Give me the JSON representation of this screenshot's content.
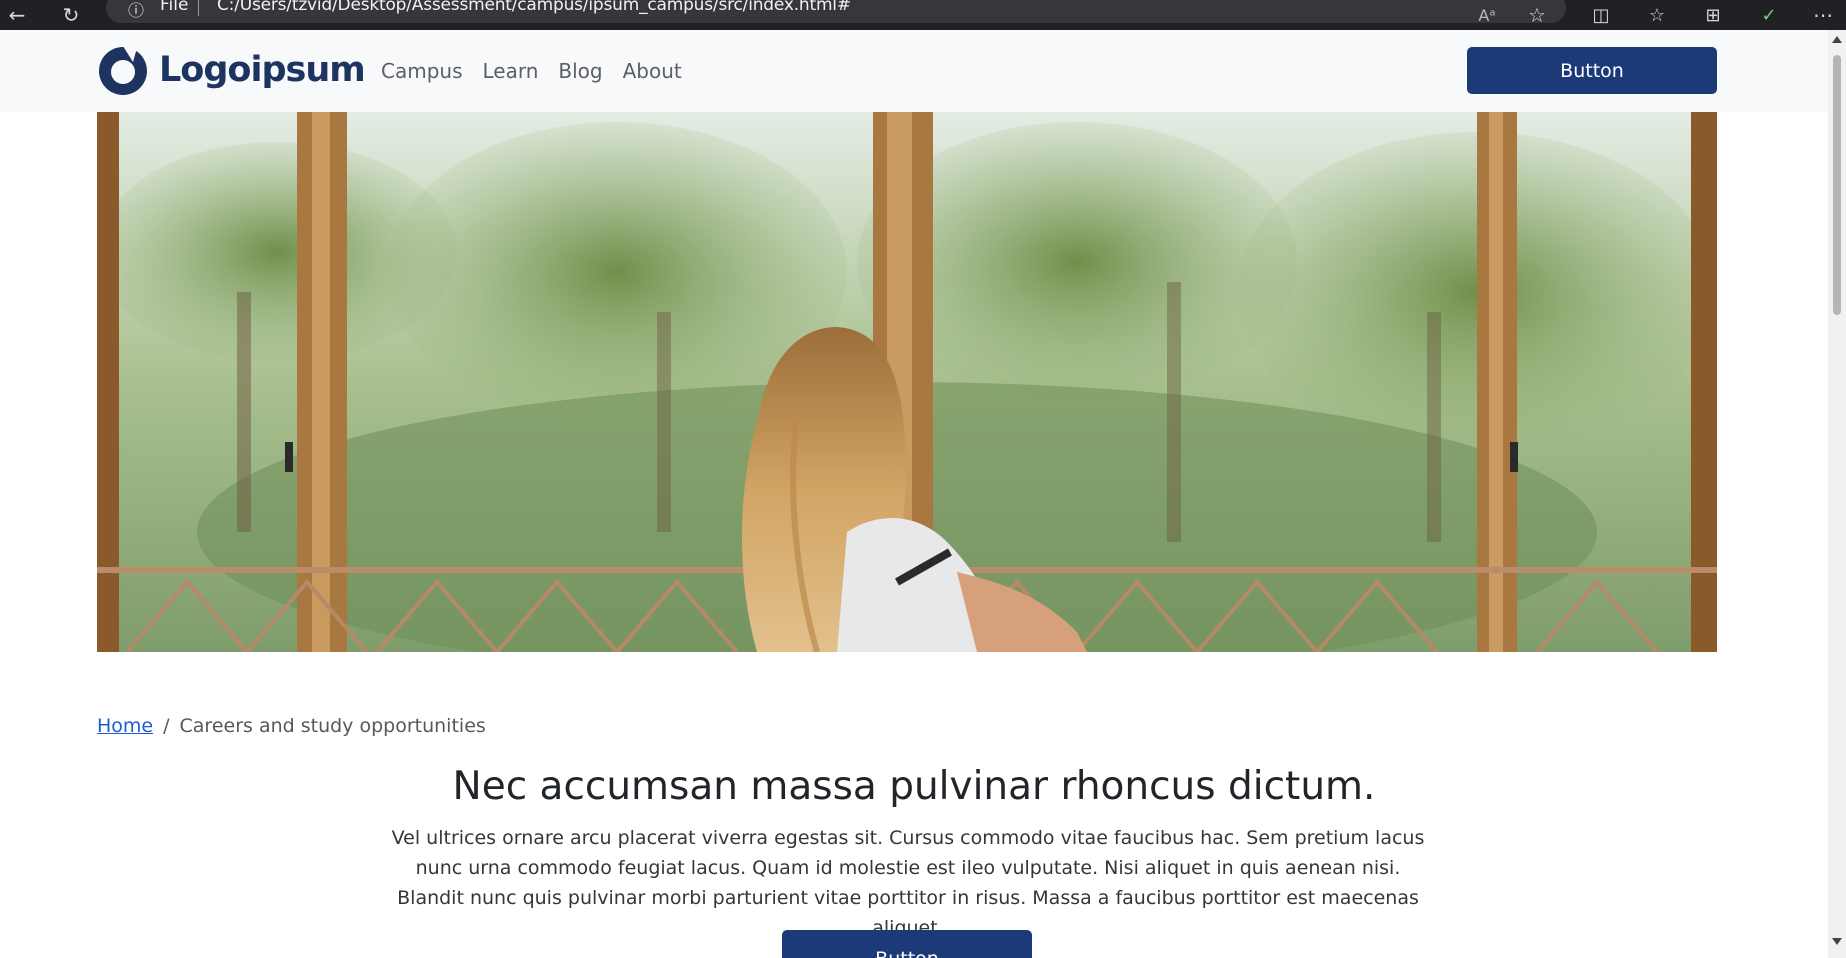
{
  "browser": {
    "file_label": "File",
    "url": "C:/Users/tzvid/Desktop/Assessment/campus/ipsum_campus/src/index.html#"
  },
  "header": {
    "logo_text": "Logoipsum",
    "nav": [
      {
        "label": "Campus"
      },
      {
        "label": "Learn"
      },
      {
        "label": "Blog"
      },
      {
        "label": "About"
      }
    ],
    "button_label": "Button"
  },
  "breadcrumb": {
    "home": "Home",
    "separator": "/",
    "current": "Careers and study opportunities"
  },
  "main": {
    "title": "Nec accumsan massa pulvinar rhoncus dictum.",
    "body": "Vel ultrices ornare arcu placerat viverra egestas sit. Cursus commodo vitae faucibus hac. Sem pretium lacus nunc urna commodo feugiat lacus. Quam id molestie est ileo vulputate. Nisi aliquet in quis aenean nisi. Blandit nunc quis pulvinar morbi parturient vitae porttitor in risus. Massa a faucibus porttitor est maecenas aliquet.",
    "button_label": "Button"
  },
  "colors": {
    "brand": "#1d3461",
    "button": "#1d3a78",
    "link": "#1f5bd1"
  }
}
